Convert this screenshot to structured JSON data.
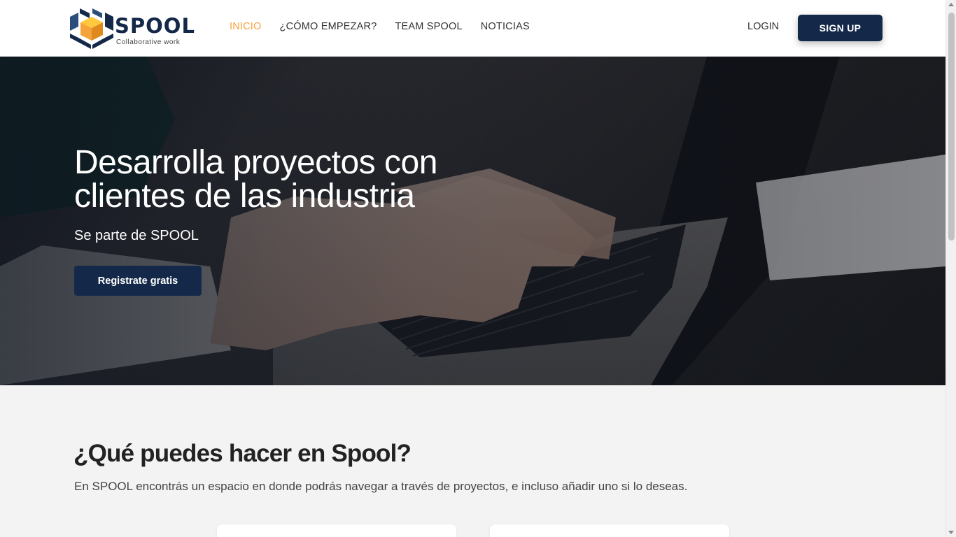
{
  "brand": {
    "name": "SPOOL",
    "tagline": "Collaborative work",
    "colors": {
      "navy": "#14294a",
      "accent": "#f5a33b"
    }
  },
  "nav": {
    "items": [
      {
        "label": "INICIO",
        "active": true
      },
      {
        "label": "¿CÓMO EMPEZAR?",
        "active": false
      },
      {
        "label": "TEAM SPOOL",
        "active": false
      },
      {
        "label": "NOTICIAS",
        "active": false
      }
    ],
    "login_label": "LOGIN",
    "signup_label": "SIGN UP"
  },
  "hero": {
    "title": "Desarrolla proyectos con clientes de las industria",
    "subtitle": "Se parte de SPOOL",
    "cta_label": "Registrate gratis",
    "background": "laptop-typing-photo"
  },
  "features": {
    "title": "¿Qué puedes hacer en Spool?",
    "description": "En SPOOL encontrás un espacio en donde podrás navegar a través de proyectos, e incluso añadir uno si lo deseas."
  }
}
